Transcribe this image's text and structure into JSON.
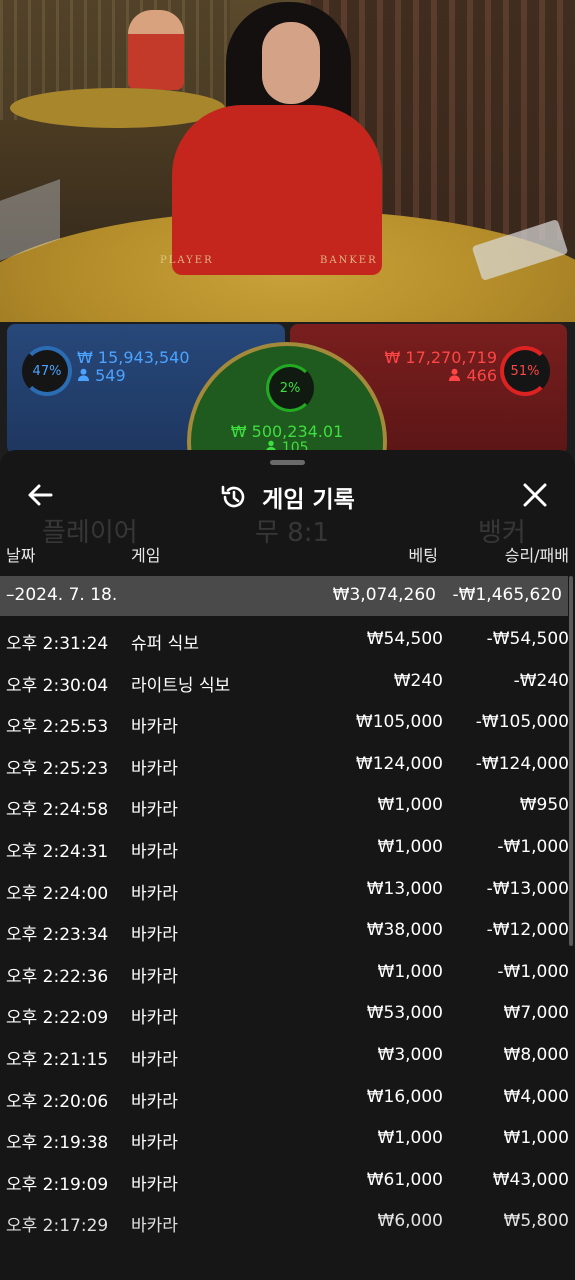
{
  "bets": {
    "player": {
      "percent": "47%",
      "amount": "₩ 15,943,540",
      "count": "549"
    },
    "tie": {
      "percent": "2%",
      "amount": "₩ 500,234.01",
      "count": "105"
    },
    "banker": {
      "percent": "51%",
      "amount": "₩ 17,270,719",
      "count": "466"
    }
  },
  "table_labels": {
    "player": "PLAYER",
    "banker": "BANKER"
  },
  "background_labels": {
    "player": "플레이어",
    "tie": "무 8:1",
    "banker": "뱅커"
  },
  "history": {
    "title": "게임 기록",
    "columns": {
      "date": "날짜",
      "game": "게임",
      "bet": "베팅",
      "result": "승리/패배"
    },
    "summary": {
      "date": "–2024. 7. 18.",
      "bet": "₩3,074,260",
      "result": "-₩1,465,620"
    },
    "rows": [
      {
        "time": "오후 2:31:24",
        "game": "슈퍼 식보",
        "bet": "₩54,500",
        "result": "-₩54,500"
      },
      {
        "time": "오후 2:30:04",
        "game": "라이트닝 식보",
        "bet": "₩240",
        "result": "-₩240"
      },
      {
        "time": "오후 2:25:53",
        "game": "바카라",
        "bet": "₩105,000",
        "result": "-₩105,000"
      },
      {
        "time": "오후 2:25:23",
        "game": "바카라",
        "bet": "₩124,000",
        "result": "-₩124,000"
      },
      {
        "time": "오후 2:24:58",
        "game": "바카라",
        "bet": "₩1,000",
        "result": "₩950"
      },
      {
        "time": "오후 2:24:31",
        "game": "바카라",
        "bet": "₩1,000",
        "result": "-₩1,000"
      },
      {
        "time": "오후 2:24:00",
        "game": "바카라",
        "bet": "₩13,000",
        "result": "-₩13,000"
      },
      {
        "time": "오후 2:23:34",
        "game": "바카라",
        "bet": "₩38,000",
        "result": "-₩12,000"
      },
      {
        "time": "오후 2:22:36",
        "game": "바카라",
        "bet": "₩1,000",
        "result": "-₩1,000"
      },
      {
        "time": "오후 2:22:09",
        "game": "바카라",
        "bet": "₩53,000",
        "result": "₩7,000"
      },
      {
        "time": "오후 2:21:15",
        "game": "바카라",
        "bet": "₩3,000",
        "result": "₩8,000"
      },
      {
        "time": "오후 2:20:06",
        "game": "바카라",
        "bet": "₩16,000",
        "result": "₩4,000"
      },
      {
        "time": "오후 2:19:38",
        "game": "바카라",
        "bet": "₩1,000",
        "result": "₩1,000"
      },
      {
        "time": "오후 2:19:09",
        "game": "바카라",
        "bet": "₩61,000",
        "result": "₩43,000"
      },
      {
        "time": "오후 2:17:29",
        "game": "바카라",
        "bet": "₩6,000",
        "result": "₩5,800"
      }
    ]
  },
  "icons": {
    "back": "arrow-left-icon",
    "history": "history-icon",
    "close": "close-icon",
    "user": "user-icon"
  },
  "colors": {
    "player": "#4ba3ff",
    "banker": "#ff4545",
    "tie": "#3dde3d",
    "summary_bg": "#4a4a4a"
  }
}
